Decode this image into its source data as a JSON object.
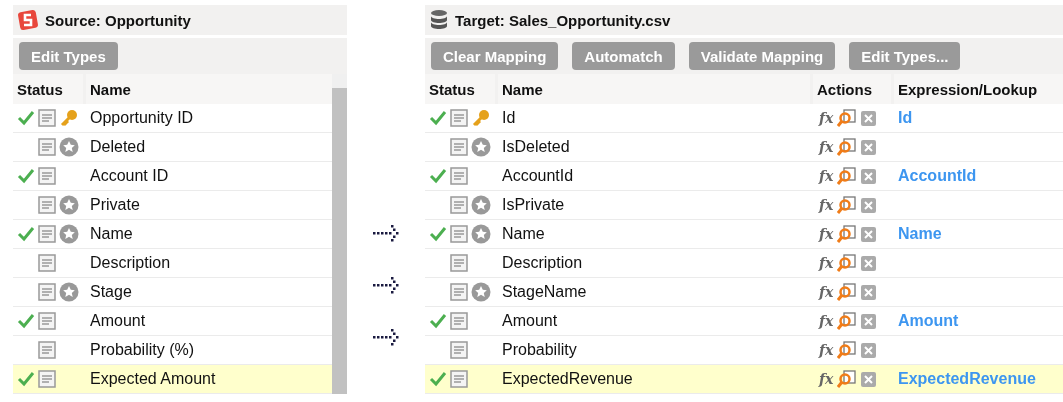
{
  "source": {
    "title": "Source: Opportunity",
    "buttons": [
      "Edit Types"
    ],
    "columns": [
      "Status",
      "Name"
    ],
    "rows": [
      {
        "name": "Opportunity ID",
        "mapped": true,
        "kind": "key",
        "selected": false
      },
      {
        "name": "Deleted",
        "mapped": false,
        "kind": "star",
        "selected": false
      },
      {
        "name": "Account ID",
        "mapped": true,
        "kind": "plain",
        "selected": false
      },
      {
        "name": "Private",
        "mapped": false,
        "kind": "star",
        "selected": false
      },
      {
        "name": "Name",
        "mapped": true,
        "kind": "star",
        "selected": false
      },
      {
        "name": "Description",
        "mapped": false,
        "kind": "plain",
        "selected": false
      },
      {
        "name": "Stage",
        "mapped": false,
        "kind": "star",
        "selected": false
      },
      {
        "name": "Amount",
        "mapped": true,
        "kind": "plain",
        "selected": false
      },
      {
        "name": "Probability (%)",
        "mapped": false,
        "kind": "plain",
        "selected": false
      },
      {
        "name": "Expected Amount",
        "mapped": true,
        "kind": "plain",
        "selected": true
      }
    ]
  },
  "target": {
    "title": "Target: Sales_Opportunity.csv",
    "buttons": [
      "Clear Mapping",
      "Automatch",
      "Validate Mapping",
      "Edit Types..."
    ],
    "columns": [
      "Status",
      "Name",
      "Actions",
      "Expression/Lookup"
    ],
    "rows": [
      {
        "name": "Id",
        "mapped": true,
        "kind": "key",
        "selected": false,
        "fx": "fx",
        "expression": "Id"
      },
      {
        "name": "IsDeleted",
        "mapped": false,
        "kind": "star",
        "selected": false,
        "fx": "fx"
      },
      {
        "name": "AccountId",
        "mapped": true,
        "kind": "plain",
        "selected": false,
        "fx": "fx",
        "expression": "AccountId"
      },
      {
        "name": "IsPrivate",
        "mapped": false,
        "kind": "star",
        "selected": false,
        "fx": "fx"
      },
      {
        "name": "Name",
        "mapped": true,
        "kind": "star",
        "selected": false,
        "fx": "fx",
        "expression": "Name"
      },
      {
        "name": "Description",
        "mapped": false,
        "kind": "plain",
        "selected": false,
        "fx": "fx"
      },
      {
        "name": "StageName",
        "mapped": false,
        "kind": "star",
        "selected": false,
        "fx": "fx"
      },
      {
        "name": "Amount",
        "mapped": true,
        "kind": "plain",
        "selected": false,
        "fx": "fx",
        "expression": "Amount"
      },
      {
        "name": "Probability",
        "mapped": false,
        "kind": "plain",
        "selected": false,
        "fx": "fx"
      },
      {
        "name": "ExpectedRevenue",
        "mapped": true,
        "kind": "plain",
        "selected": true,
        "fx": "fx",
        "expression": "ExpectedRevenue"
      }
    ]
  }
}
